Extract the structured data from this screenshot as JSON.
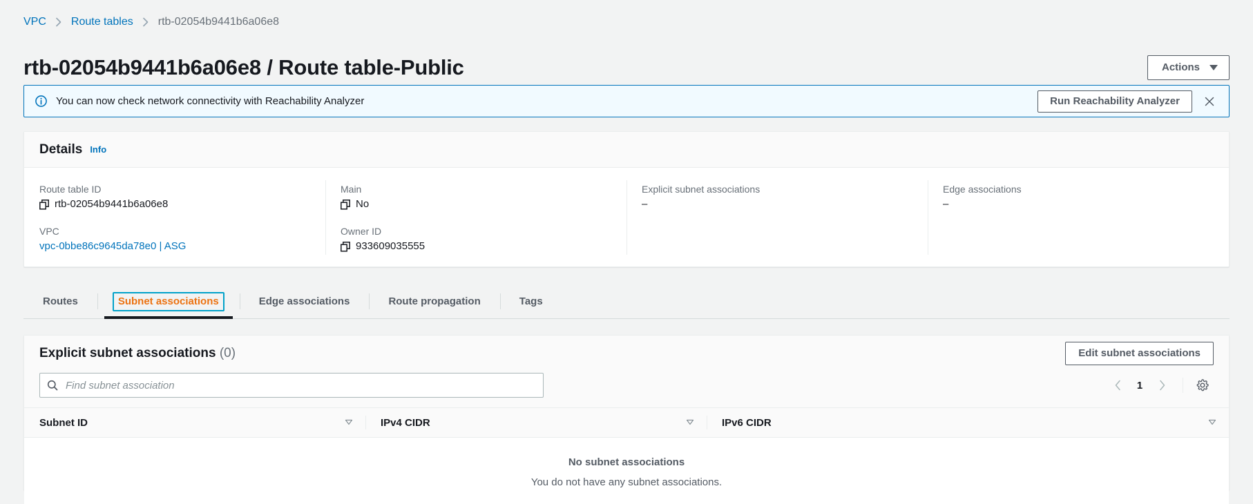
{
  "breadcrumb": {
    "items": [
      {
        "label": "VPC",
        "type": "link"
      },
      {
        "label": "Route tables",
        "type": "link"
      },
      {
        "label": "rtb-02054b9441b6a06e8",
        "type": "current"
      }
    ]
  },
  "header": {
    "title": "rtb-02054b9441b6a06e8 / Route table-Public",
    "actions_label": "Actions"
  },
  "flash": {
    "icon": "info-icon",
    "message": "You can now check network connectivity with Reachability Analyzer",
    "action_label": "Run Reachability Analyzer",
    "close_icon": "close-icon",
    "background": "#f1faff",
    "border": "#0073bb"
  },
  "details": {
    "title": "Details",
    "info_label": "Info",
    "columns": [
      {
        "fields": [
          {
            "label": "Route table ID",
            "value": "rtb-02054b9441b6a06e8",
            "copyable": true,
            "link": false
          },
          {
            "label": "VPC",
            "value": "vpc-0bbe86c9645da78e0 | ASG",
            "copyable": false,
            "link": true
          }
        ]
      },
      {
        "fields": [
          {
            "label": "Main",
            "value": "No",
            "copyable": true,
            "link": false
          },
          {
            "label": "Owner ID",
            "value": "933609035555",
            "copyable": true,
            "link": false
          }
        ]
      },
      {
        "fields": [
          {
            "label": "Explicit subnet associations",
            "value": "–",
            "copyable": false,
            "link": false
          }
        ]
      },
      {
        "fields": [
          {
            "label": "Edge associations",
            "value": "–",
            "copyable": false,
            "link": false
          }
        ]
      }
    ]
  },
  "tabs": [
    {
      "label": "Routes",
      "active": false
    },
    {
      "label": "Subnet associations",
      "active": true
    },
    {
      "label": "Edge associations",
      "active": false
    },
    {
      "label": "Route propagation",
      "active": false
    },
    {
      "label": "Tags",
      "active": false
    }
  ],
  "table_section": {
    "title": "Explicit subnet associations",
    "count": "(0)",
    "edit_button_label": "Edit subnet associations",
    "search": {
      "placeholder": "Find subnet association",
      "value": "",
      "icon": "search-icon"
    },
    "pagination": {
      "prev_icon": "chevron-left-icon",
      "next_icon": "chevron-right-icon",
      "current_page": "1"
    },
    "settings_icon": "gear-icon",
    "columns": [
      {
        "label": "Subnet ID",
        "sort_icon": "sort-descending-icon"
      },
      {
        "label": "IPv4 CIDR",
        "sort_icon": "sort-descending-icon"
      },
      {
        "label": "IPv6 CIDR",
        "sort_icon": "sort-descending-icon"
      }
    ],
    "rows": [],
    "empty": {
      "title": "No subnet associations",
      "subtitle": "You do not have any subnet associations."
    }
  },
  "theme": {
    "page_background": "#f2f3f3",
    "link": "#0073bb",
    "accent_active_tab": "#ec7211",
    "focus_ring": "#00a1c9",
    "muted_text": "#687078"
  }
}
